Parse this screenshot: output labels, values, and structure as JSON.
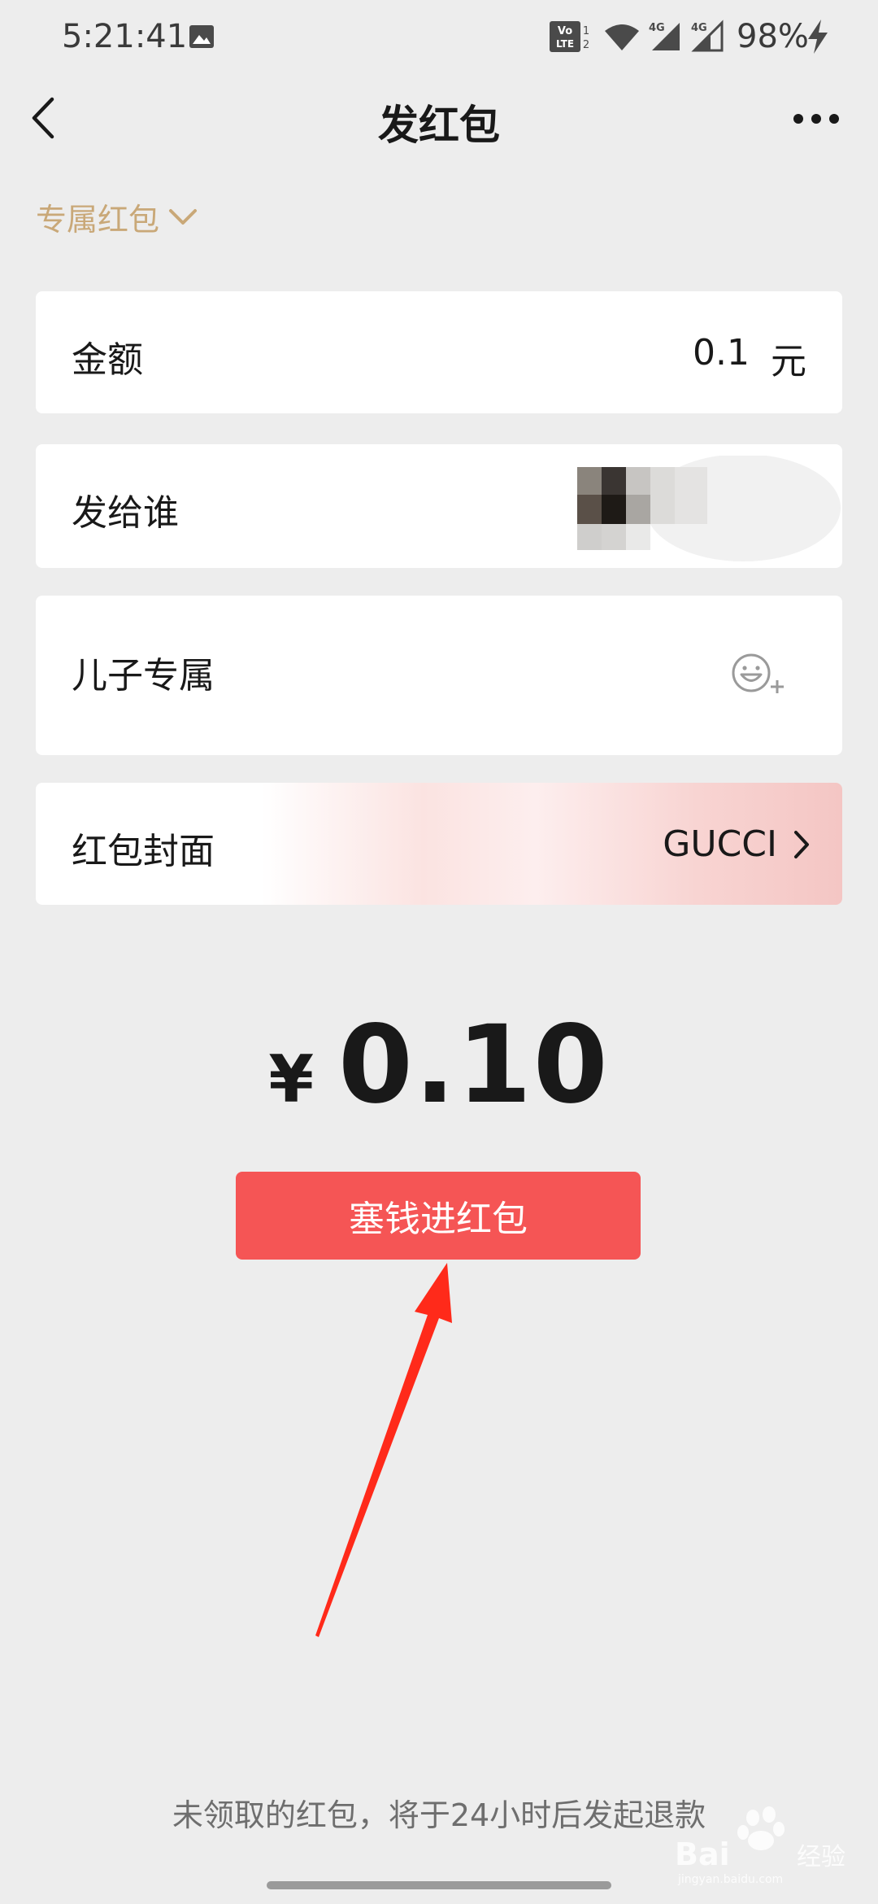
{
  "status_bar": {
    "time": "5:21:41",
    "battery": "98%",
    "icons": [
      "gallery-icon",
      "volte-icon",
      "wifi-icon",
      "signal-4g-icon",
      "signal-4g-icon",
      "charging-bolt-icon"
    ]
  },
  "nav": {
    "title": "发红包",
    "back_icon": "chevron-left-icon",
    "more_icon": "more-dots-icon"
  },
  "type_selector": {
    "label": "专属红包",
    "icon": "chevron-down-icon"
  },
  "form": {
    "amount": {
      "label": "金额",
      "value": "0.1",
      "unit": "元"
    },
    "recipient": {
      "label": "发给谁"
    },
    "greeting": {
      "value": "儿子专属",
      "icon": "emoji-add-icon"
    },
    "cover": {
      "label": "红包封面",
      "value": "GUCCI",
      "icon": "chevron-right-icon"
    }
  },
  "total": {
    "currency": "¥",
    "value": "0.10"
  },
  "submit": {
    "label": "塞钱进红包"
  },
  "footer": {
    "note": "未领取的红包，将于24小时后发起退款"
  },
  "watermark": {
    "text": "Baidu经验",
    "sub": "jingyan.baidu.com"
  },
  "colors": {
    "background": "#ededed",
    "card": "#ffffff",
    "accent_gold": "#c9a878",
    "button_red": "#f55555",
    "arrow_red": "#ff2a1a"
  }
}
